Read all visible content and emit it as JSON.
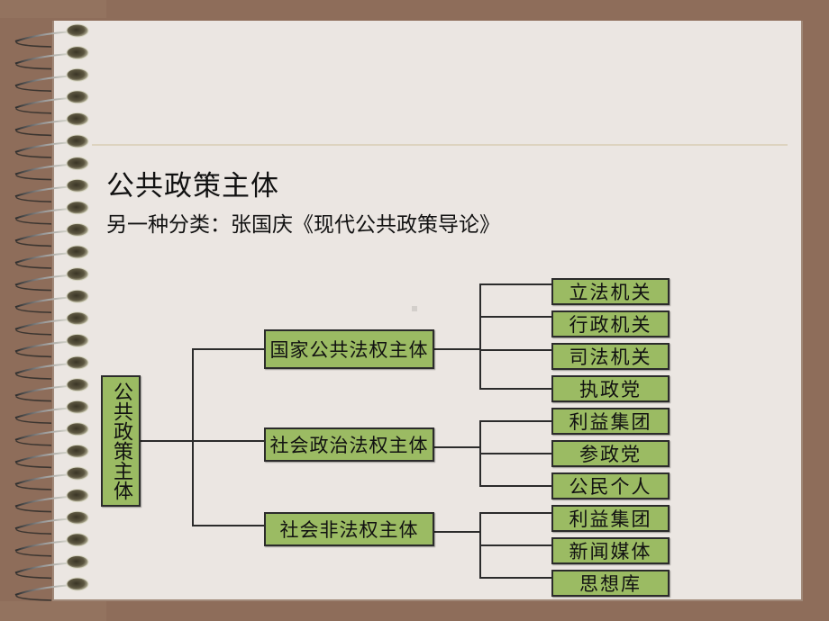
{
  "slide": {
    "title": "公共政策主体",
    "subtitle": "另一种分类：张国庆《现代公共政策导论》"
  },
  "colors": {
    "background": "#8e6d5a",
    "page": "#ebe6e2",
    "rule": "#ddd3bf",
    "box_fill": "#9bbb63",
    "box_border": "#2b2b2b"
  },
  "diagram": {
    "root": {
      "label": "公共政策主体"
    },
    "branches": [
      {
        "label": "国家公共法权主体",
        "children": [
          "立法机关",
          "行政机关",
          "司法机关",
          "执政党"
        ]
      },
      {
        "label": "社会政治法权主体",
        "children": [
          "利益集团",
          "参政党",
          "公民个人"
        ]
      },
      {
        "label": "社会非法权主体",
        "children": [
          "利益集团",
          "新闻媒体",
          "思想库"
        ]
      }
    ]
  }
}
